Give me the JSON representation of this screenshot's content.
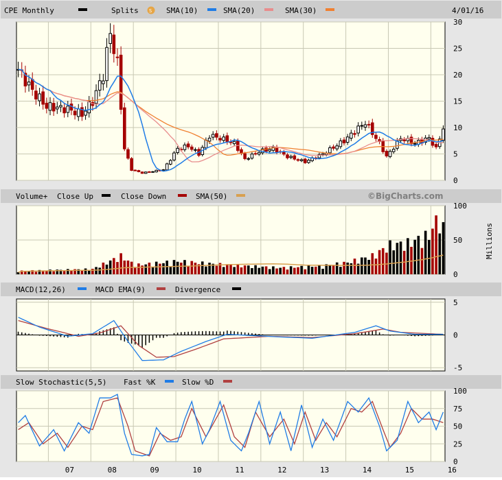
{
  "header": {
    "ticker_label": "CPE Monthly",
    "splits_label": "Splits",
    "sma10_label": "SMA(10)",
    "sma20_label": "SMA(20)",
    "sma30_label": "SMA(30)",
    "date": "4/01/16"
  },
  "volume_header": {
    "label": "Volume+",
    "close_up_label": "Close Up",
    "close_down_label": "Close Down",
    "sma50_label": "SMA(50)",
    "brand": "©BigCharts.com",
    "units_label": "Millions"
  },
  "macd_header": {
    "macd_label": "MACD(12,26)",
    "ema_label": "MACD EMA(9)",
    "divergence_label": "Divergence"
  },
  "stoch_header": {
    "label": "Slow Stochastic(5,5)",
    "fast_label": "Fast %K",
    "slow_label": "Slow %D"
  },
  "colors": {
    "background": "#ffffff",
    "panel_fill": "#ffffee",
    "header_bar": "#cccccc",
    "grid": "#c8c8b4",
    "up": "#000000",
    "down": "#a50000",
    "sma10": "#1f7ce6",
    "sma20": "#e88d8d",
    "sma30": "#f08030",
    "sma50_volume": "#d8a050",
    "macd": "#1f7ce6",
    "macd_ema": "#b04040",
    "fast_k": "#1f7ce6",
    "slow_d": "#b04040"
  },
  "chart_data": [
    {
      "type": "candlestick",
      "name": "price",
      "x_tick_labels": [
        "07",
        "08",
        "09",
        "10",
        "11",
        "12",
        "13",
        "14",
        "15",
        "16"
      ],
      "y_ticks": [
        0,
        5,
        10,
        15,
        20,
        25,
        30
      ],
      "ylim": [
        0,
        30
      ],
      "start_month": "2006-04",
      "end_month": "2016-04",
      "close_anchors": [
        [
          "2006-04",
          21
        ],
        [
          "2006-08",
          17
        ],
        [
          "2006-12",
          14
        ],
        [
          "2007-06",
          13.5
        ],
        [
          "2007-10",
          12.5
        ],
        [
          "2008-01",
          15
        ],
        [
          "2008-04",
          20
        ],
        [
          "2008-06",
          28
        ],
        [
          "2008-08",
          22
        ],
        [
          "2008-10",
          6
        ],
        [
          "2008-12",
          2
        ],
        [
          "2009-03",
          1.4
        ],
        [
          "2009-09",
          2
        ],
        [
          "2009-11",
          4
        ],
        [
          "2010-01",
          6
        ],
        [
          "2010-04",
          6.5
        ],
        [
          "2010-07",
          5
        ],
        [
          "2010-10",
          8.5
        ],
        [
          "2011-01",
          8
        ],
        [
          "2011-05",
          7
        ],
        [
          "2011-08",
          4
        ],
        [
          "2011-12",
          5.5
        ],
        [
          "2012-04",
          6
        ],
        [
          "2012-08",
          4.5
        ],
        [
          "2013-01",
          3.5
        ],
        [
          "2013-06",
          5
        ],
        [
          "2013-12",
          7.5
        ],
        [
          "2014-06",
          11
        ],
        [
          "2014-10",
          7
        ],
        [
          "2014-12",
          4.5
        ],
        [
          "2015-04",
          8
        ],
        [
          "2015-08",
          7
        ],
        [
          "2015-12",
          8
        ],
        [
          "2016-02",
          6
        ],
        [
          "2016-04",
          10
        ]
      ]
    },
    {
      "type": "bar",
      "name": "volume",
      "units": "Millions",
      "y_ticks": [
        0,
        50,
        100
      ],
      "ylim": [
        0,
        100
      ],
      "value_anchors": [
        [
          "2006-04",
          5
        ],
        [
          "2008-01",
          8
        ],
        [
          "2008-09",
          28
        ],
        [
          "2009-01",
          14
        ],
        [
          "2010-01",
          20
        ],
        [
          "2011-01",
          15
        ],
        [
          "2012-06",
          10
        ],
        [
          "2013-06",
          13
        ],
        [
          "2014-01",
          18
        ],
        [
          "2014-08",
          28
        ],
        [
          "2015-01",
          45
        ],
        [
          "2015-06",
          48
        ],
        [
          "2015-12",
          60
        ],
        [
          "2016-03",
          92
        ],
        [
          "2016-04",
          70
        ]
      ]
    },
    {
      "type": "line",
      "name": "macd",
      "y_ticks": [
        -5,
        0,
        5
      ],
      "ylim": [
        -5.5,
        5.5
      ],
      "series": [
        {
          "name": "MACD(12,26)",
          "anchors": [
            [
              "2006-04",
              2.7
            ],
            [
              "2006-10",
              1.2
            ],
            [
              "2007-06",
              -0.2
            ],
            [
              "2008-01",
              0.2
            ],
            [
              "2008-07",
              2.2
            ],
            [
              "2008-11",
              -1.0
            ],
            [
              "2009-03",
              -3.9
            ],
            [
              "2009-09",
              -3.8
            ],
            [
              "2010-02",
              -2.5
            ],
            [
              "2010-09",
              -1.0
            ],
            [
              "2011-03",
              0.1
            ],
            [
              "2012-06",
              -0.3
            ],
            [
              "2013-03",
              -0.5
            ],
            [
              "2014-03",
              0.4
            ],
            [
              "2014-09",
              1.4
            ],
            [
              "2015-01",
              0.6
            ],
            [
              "2015-08",
              0.1
            ],
            [
              "2016-04",
              0.1
            ]
          ]
        },
        {
          "name": "MACD EMA(9)",
          "anchors": [
            [
              "2006-04",
              2.2
            ],
            [
              "2006-12",
              1.0
            ],
            [
              "2007-09",
              -0.2
            ],
            [
              "2008-03",
              0.3
            ],
            [
              "2008-09",
              1.4
            ],
            [
              "2009-02",
              -1.6
            ],
            [
              "2009-07",
              -3.4
            ],
            [
              "2009-12",
              -3.3
            ],
            [
              "2010-06",
              -2.2
            ],
            [
              "2011-02",
              -0.6
            ],
            [
              "2012-03",
              -0.2
            ],
            [
              "2013-03",
              -0.4
            ],
            [
              "2014-03",
              0.2
            ],
            [
              "2014-11",
              0.9
            ],
            [
              "2015-04",
              0.4
            ],
            [
              "2016-04",
              0.1
            ]
          ]
        }
      ]
    },
    {
      "type": "line",
      "name": "slow_stochastic",
      "y_ticks": [
        0,
        25,
        50,
        75,
        100
      ],
      "ylim": [
        0,
        100
      ],
      "series": [
        {
          "name": "Fast %K",
          "anchors": [
            [
              "2006-04",
              55
            ],
            [
              "2006-06",
              65
            ],
            [
              "2006-10",
              22
            ],
            [
              "2007-02",
              45
            ],
            [
              "2007-05",
              15
            ],
            [
              "2007-09",
              55
            ],
            [
              "2007-12",
              40
            ],
            [
              "2008-03",
              90
            ],
            [
              "2008-06",
              90
            ],
            [
              "2008-08",
              95
            ],
            [
              "2008-10",
              40
            ],
            [
              "2008-12",
              10
            ],
            [
              "2009-03",
              8
            ],
            [
              "2009-05",
              10
            ],
            [
              "2009-07",
              48
            ],
            [
              "2009-10",
              28
            ],
            [
              "2010-01",
              28
            ],
            [
              "2010-03",
              60
            ],
            [
              "2010-05",
              85
            ],
            [
              "2010-08",
              25
            ],
            [
              "2010-10",
              45
            ],
            [
              "2011-01",
              85
            ],
            [
              "2011-04",
              30
            ],
            [
              "2011-07",
              15
            ],
            [
              "2011-09",
              40
            ],
            [
              "2011-12",
              85
            ],
            [
              "2012-03",
              25
            ],
            [
              "2012-06",
              70
            ],
            [
              "2012-09",
              15
            ],
            [
              "2012-12",
              80
            ],
            [
              "2013-03",
              20
            ],
            [
              "2013-06",
              60
            ],
            [
              "2013-09",
              30
            ],
            [
              "2014-01",
              85
            ],
            [
              "2014-04",
              70
            ],
            [
              "2014-07",
              90
            ],
            [
              "2014-10",
              50
            ],
            [
              "2014-12",
              15
            ],
            [
              "2015-03",
              30
            ],
            [
              "2015-06",
              85
            ],
            [
              "2015-09",
              55
            ],
            [
              "2015-12",
              70
            ],
            [
              "2016-02",
              45
            ],
            [
              "2016-04",
              70
            ]
          ]
        },
        {
          "name": "Slow %D",
          "anchors": [
            [
              "2006-04",
              45
            ],
            [
              "2006-07",
              55
            ],
            [
              "2006-11",
              25
            ],
            [
              "2007-03",
              40
            ],
            [
              "2007-06",
              20
            ],
            [
              "2007-10",
              50
            ],
            [
              "2008-01",
              45
            ],
            [
              "2008-04",
              85
            ],
            [
              "2008-08",
              90
            ],
            [
              "2008-11",
              50
            ],
            [
              "2009-01",
              15
            ],
            [
              "2009-05",
              8
            ],
            [
              "2009-08",
              40
            ],
            [
              "2009-11",
              30
            ],
            [
              "2010-02",
              35
            ],
            [
              "2010-05",
              75
            ],
            [
              "2010-09",
              35
            ],
            [
              "2011-02",
              80
            ],
            [
              "2011-05",
              35
            ],
            [
              "2011-08",
              20
            ],
            [
              "2011-11",
              70
            ],
            [
              "2012-03",
              35
            ],
            [
              "2012-07",
              60
            ],
            [
              "2012-10",
              25
            ],
            [
              "2013-01",
              70
            ],
            [
              "2013-04",
              30
            ],
            [
              "2013-07",
              55
            ],
            [
              "2013-10",
              35
            ],
            [
              "2014-02",
              75
            ],
            [
              "2014-05",
              70
            ],
            [
              "2014-08",
              85
            ],
            [
              "2014-11",
              45
            ],
            [
              "2015-01",
              20
            ],
            [
              "2015-04",
              40
            ],
            [
              "2015-07",
              75
            ],
            [
              "2015-10",
              60
            ],
            [
              "2016-01",
              60
            ],
            [
              "2016-04",
              55
            ]
          ]
        }
      ]
    }
  ]
}
